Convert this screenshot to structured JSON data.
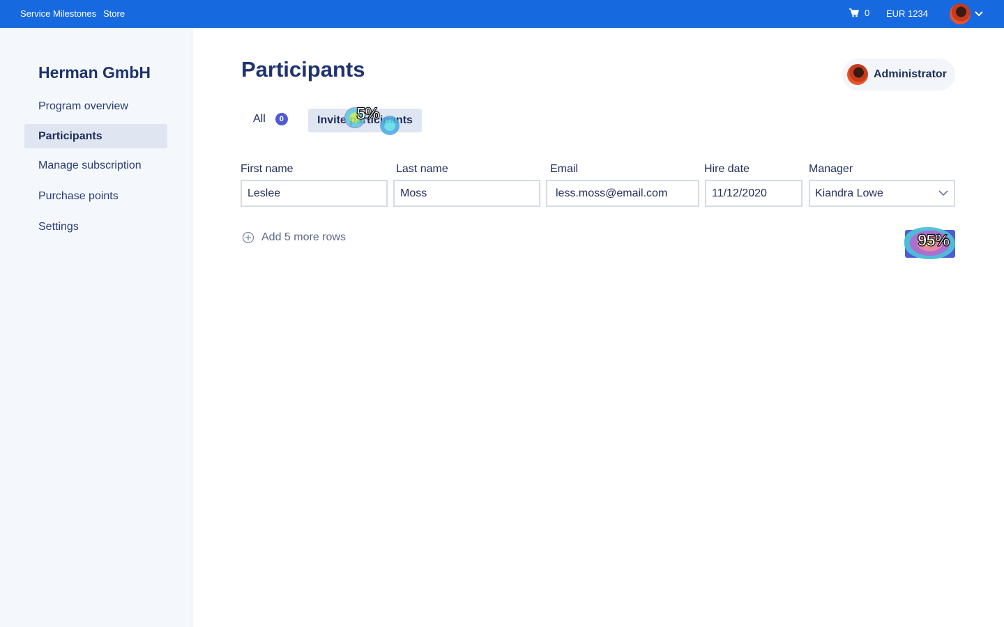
{
  "topbar": {
    "links": [
      "Service Milestones",
      "Store"
    ],
    "cart_count": "0",
    "balance": "EUR 1234"
  },
  "sidebar": {
    "company": "Herman GmbH",
    "items": [
      {
        "label": "Program overview"
      },
      {
        "label": "Participants"
      },
      {
        "label": "Manage subscription"
      },
      {
        "label": "Purchase points"
      },
      {
        "label": "Settings"
      }
    ],
    "active_item": "Participants"
  },
  "main": {
    "title": "Participants",
    "role": "Administrator",
    "tabs": [
      {
        "label": "All",
        "count": "0"
      },
      {
        "label": "Invite participants"
      }
    ],
    "form": {
      "first_name": {
        "label": "First name",
        "value": "Leslee"
      },
      "last_name": {
        "label": "Last name",
        "value": "Moss"
      },
      "email": {
        "label": "Email",
        "value": "less.moss@email.com"
      },
      "hire_date": {
        "label": "Hire date",
        "value": "11/12/2020"
      },
      "manager": {
        "label": "Manager",
        "value": "Kiandra Lowe"
      }
    },
    "add_rows_label": "Add 5 more rows"
  },
  "overlays": {
    "tab_pct": "5%",
    "button_pct": "95%"
  },
  "colors": {
    "topbar": "#1769e0",
    "accent": "#4f5bd5",
    "sidebar_bg": "#f4f8fd"
  }
}
